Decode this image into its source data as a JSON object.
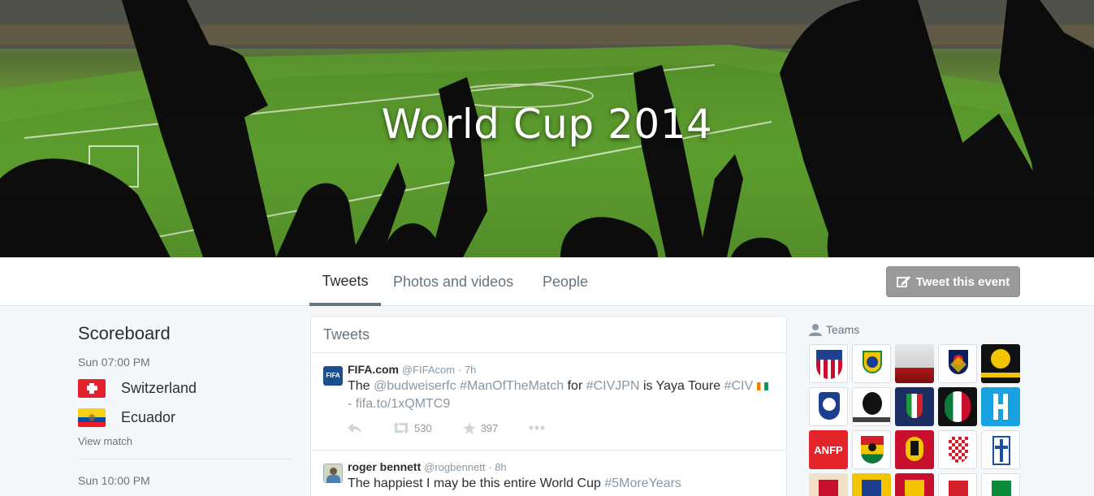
{
  "banner": {
    "title": "World Cup 2014"
  },
  "nav": {
    "tabs": [
      {
        "label": "Tweets",
        "active": true
      },
      {
        "label": "Photos and videos",
        "active": false
      },
      {
        "label": "People",
        "active": false
      }
    ],
    "tweet_event_button": "Tweet this event"
  },
  "scoreboard": {
    "title": "Scoreboard",
    "matches": [
      {
        "time": "Sun 07:00 PM",
        "team1": "Switzerland",
        "team2": "Ecuador",
        "view_match": "View match"
      },
      {
        "time": "Sun 10:00 PM"
      }
    ]
  },
  "tweets": {
    "header": "Tweets",
    "items": [
      {
        "name": "FIFA.com",
        "handle": "@FIFAcom",
        "time": "· 7h",
        "text_parts": [
          "The ",
          "@budweiserfc",
          " ",
          "#ManOfTheMatch",
          " for ",
          "#CIVJPN",
          " is Yaya Toure ",
          "#CIV"
        ],
        "text_line2": "- fifa.to/1xQMTC9",
        "retweets": "530",
        "favorites": "397"
      },
      {
        "name": "roger bennett",
        "handle": "@rogbennett",
        "time": "· 8h",
        "text_parts": [
          "The happiest I may be this entire World Cup ",
          "#5MoreYears"
        ]
      }
    ]
  },
  "teams": {
    "label": "Teams"
  },
  "colors": {
    "accent_grey": "#9a9a9a",
    "link": "#8899a6",
    "text": "#292f33"
  }
}
